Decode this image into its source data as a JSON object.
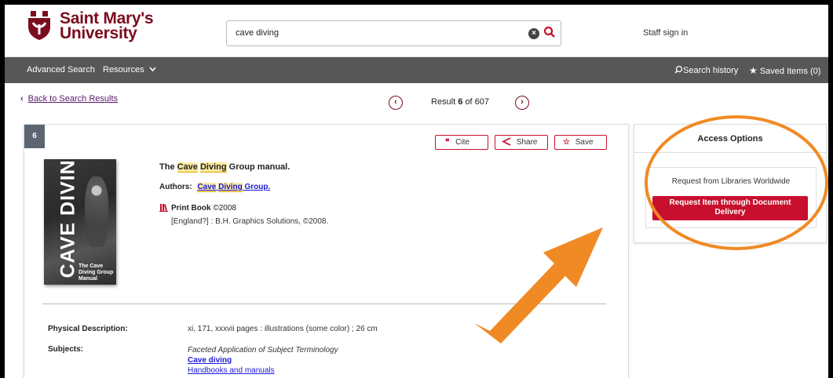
{
  "header": {
    "logo_line1": "Saint Mary's",
    "logo_line2": "University",
    "search_value": "cave diving",
    "staff_signin": "Staff sign in"
  },
  "nav": {
    "advanced_search": "Advanced Search",
    "resources": "Resources",
    "search_history": "Search history",
    "saved_items": "Saved Items (0)"
  },
  "results_nav": {
    "back": "Back to Search Results",
    "result_prefix": "Result",
    "result_index": "6",
    "result_of": "of 607"
  },
  "record": {
    "number": "6",
    "cite": "Cite",
    "share": "Share",
    "save": "Save",
    "title_pre": "The",
    "title_hl1": "Cave",
    "title_hl2": "Diving",
    "title_post": "Group manual.",
    "authors_label": "Authors:",
    "author_hl1": "Cave",
    "author_hl2": "Diving",
    "author_post": "Group.",
    "format": "Print Book",
    "year": "©2008",
    "publisher": "[England?] : B.H. Graphics Solutions, ©2008.",
    "cover_title": "CAVE DIVING",
    "cover_subtitle": "The Cave Diving Group Manual",
    "physical_label": "Physical Description:",
    "physical_value": "xi, 171, xxxvii pages : illustrations (some color) ; 26 cm",
    "subjects_label": "Subjects:",
    "subjects_source": "Faceted Application of Subject Terminology",
    "subjects": [
      "Cave diving",
      "Handbooks and manuals"
    ]
  },
  "access": {
    "heading": "Access Options",
    "request_label": "Request from Libraries Worldwide",
    "request_button_line1": "Request Item through Document",
    "request_button_line2": "Delivery"
  },
  "colors": {
    "brand": "#7a0d1e",
    "accent": "#c8102e",
    "nav_bg": "#575757",
    "annotation": "#f08a24"
  },
  "icons": {
    "clear": "clear-x-icon",
    "search": "search-icon",
    "history": "search-history-icon",
    "saved": "star-icon",
    "cite": "quote-icon",
    "share": "share-icon",
    "save": "star-outline-icon",
    "format": "book-icon"
  }
}
